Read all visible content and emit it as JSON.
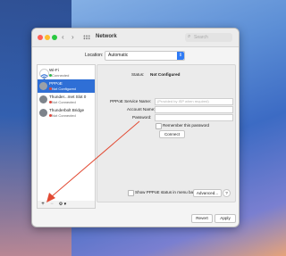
{
  "window": {
    "title": "Network"
  },
  "nav": {
    "back": "‹",
    "forward": "›"
  },
  "search": {
    "placeholder": "Search",
    "icon": "search-icon"
  },
  "location": {
    "label": "Location:",
    "value": "Automatic"
  },
  "sidebar": {
    "items": [
      {
        "name": "Wi-Fi",
        "status": "Connected",
        "status_color": "#2eb84b"
      },
      {
        "name": "PPPoE",
        "status": "Not Configured",
        "status_color": "#e0453a"
      },
      {
        "name": "Thunder...met Slot 0",
        "status": "Not Connected",
        "status_color": "#e0453a"
      },
      {
        "name": "Thunderbolt Bridge",
        "status": "Not Connected",
        "status_color": "#e0453a"
      }
    ],
    "add_label": "+",
    "remove_label": "−",
    "action_label": "⚙︎ ▾"
  },
  "main": {
    "status_label": "Status:",
    "status_value": "Not Configured",
    "service_name_label": "PPPoE Service Name:",
    "service_name_placeholder": "(Provided by ISP when required)",
    "account_name_label": "Account Name:",
    "password_label": "Password:",
    "remember_label": "Remember this password",
    "connect_label": "Connect",
    "show_status_label": "Show PPPoE status in menu bar",
    "advanced_label": "Advanced...",
    "help_label": "?"
  },
  "footer": {
    "revert_label": "Revert",
    "apply_label": "Apply"
  },
  "colors": {
    "accent": "#2f6fd6",
    "annotation_arrow": "#e24a33"
  }
}
